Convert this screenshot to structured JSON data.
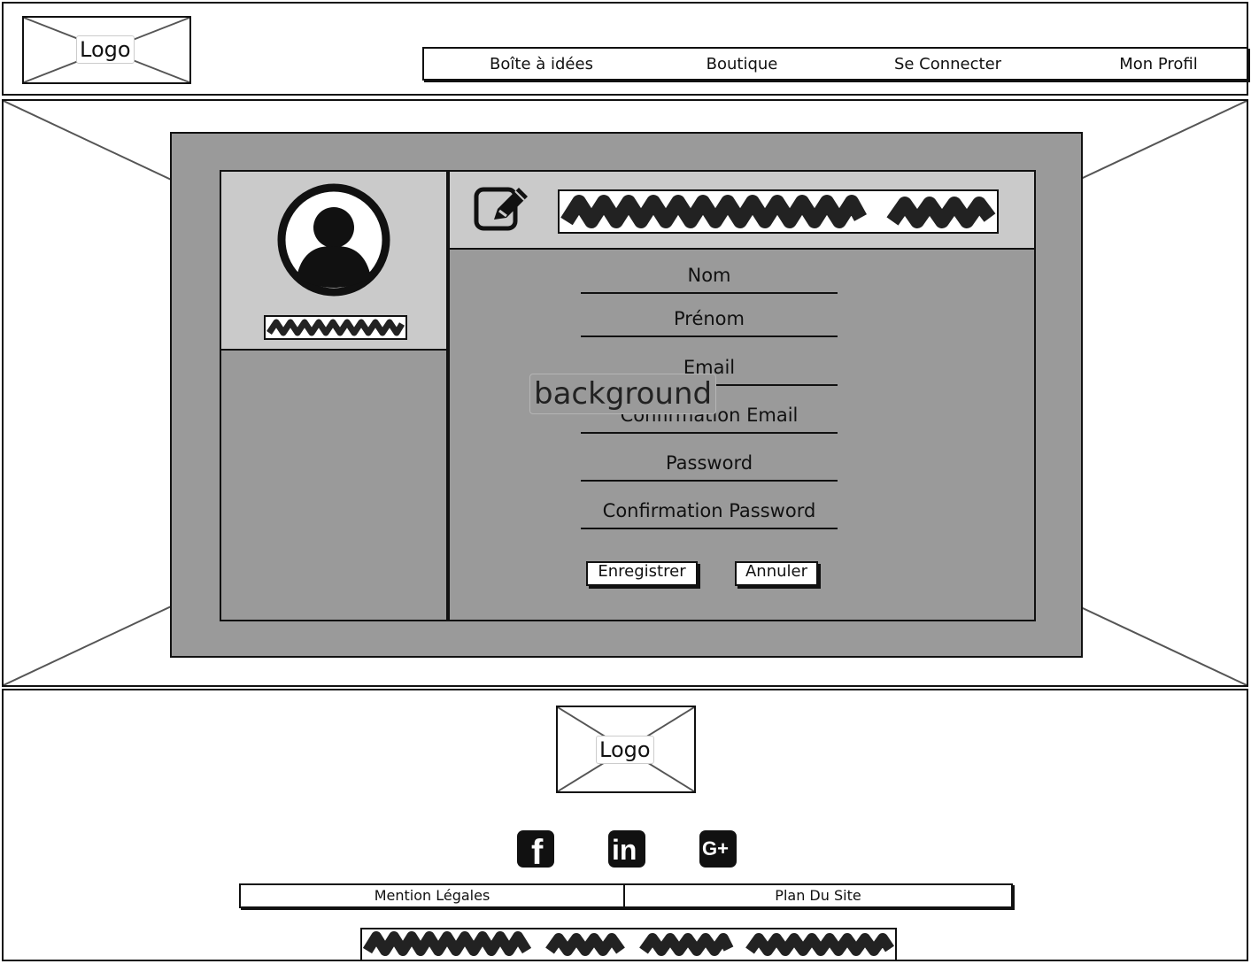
{
  "header": {
    "logo_label": "Logo",
    "nav": [
      {
        "label": "Boîte à idées"
      },
      {
        "label": "Boutique"
      },
      {
        "label": "Se Connecter"
      },
      {
        "label": "Mon Profil"
      }
    ]
  },
  "main": {
    "background_label": "background",
    "profile": {
      "avatar_icon": "user-avatar-icon",
      "edit_icon": "edit-pencil-icon"
    },
    "form": {
      "fields": [
        {
          "label": "Nom"
        },
        {
          "label": "Prénom"
        },
        {
          "label": "Email"
        },
        {
          "label": "Confirmation Email"
        },
        {
          "label": "Password"
        },
        {
          "label": "Confirmation Password"
        }
      ],
      "save_label": "Enregistrer",
      "cancel_label": "Annuler"
    }
  },
  "footer": {
    "logo_label": "Logo",
    "social": [
      {
        "icon": "facebook-icon",
        "glyph": "f"
      },
      {
        "icon": "linkedin-icon",
        "glyph": "in"
      },
      {
        "icon": "google-plus-icon",
        "glyph": "G+"
      }
    ],
    "links": [
      {
        "label": "Mention Légales"
      },
      {
        "label": "Plan Du Site"
      }
    ]
  },
  "colors": {
    "panel": "#9a9a9a",
    "light_panel": "#cacaca",
    "ink": "#111111"
  }
}
